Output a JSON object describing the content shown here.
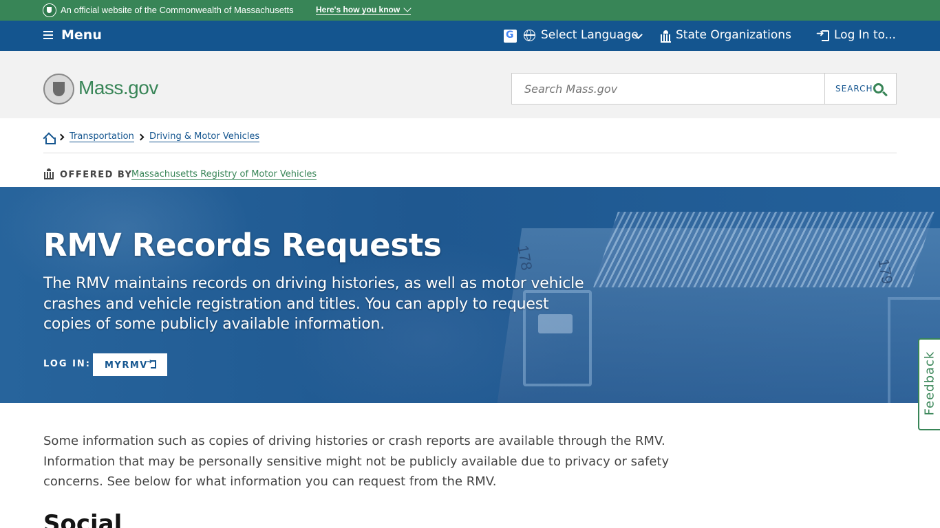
{
  "official_banner": {
    "text": "An official website of the Commonwealth of Massachusetts",
    "how_link": "Here's how you know"
  },
  "utility_nav": {
    "menu_label": "Menu",
    "language_label": "Select Language",
    "state_orgs_label": "State Organizations",
    "login_label": "Log In to..."
  },
  "header": {
    "logo_text": "Mass.gov",
    "search_placeholder": "Search Mass.gov",
    "search_button": "SEARCH"
  },
  "breadcrumb": {
    "items": [
      "Transportation",
      "Driving & Motor Vehicles"
    ]
  },
  "offered_by": {
    "label": "OFFERED BY",
    "org": "Massachusetts Registry of Motor Vehicles"
  },
  "hero": {
    "title": "RMV Records Requests",
    "description": "The RMV maintains records on driving histories, as well as motor vehicle crashes and vehicle registration and titles. You can apply to request copies of some publicly available information.",
    "login_label": "LOG IN:",
    "myrmv_label": "MYRMV",
    "image_labels": [
      "178",
      "179"
    ]
  },
  "feedback_label": "Feedback",
  "intro_text": "Some information such as copies of driving histories or crash reports are available through the RMV. Information that may be personally sensitive might not be publicly available due to privacy or safety concerns. See below for what information you can request from the RMV.",
  "section_heading": "Social",
  "colors": {
    "official_green": "#388557",
    "nav_blue": "#14558f",
    "header_gray": "#f2f2f2",
    "hero_blue": "#1f5a91"
  }
}
